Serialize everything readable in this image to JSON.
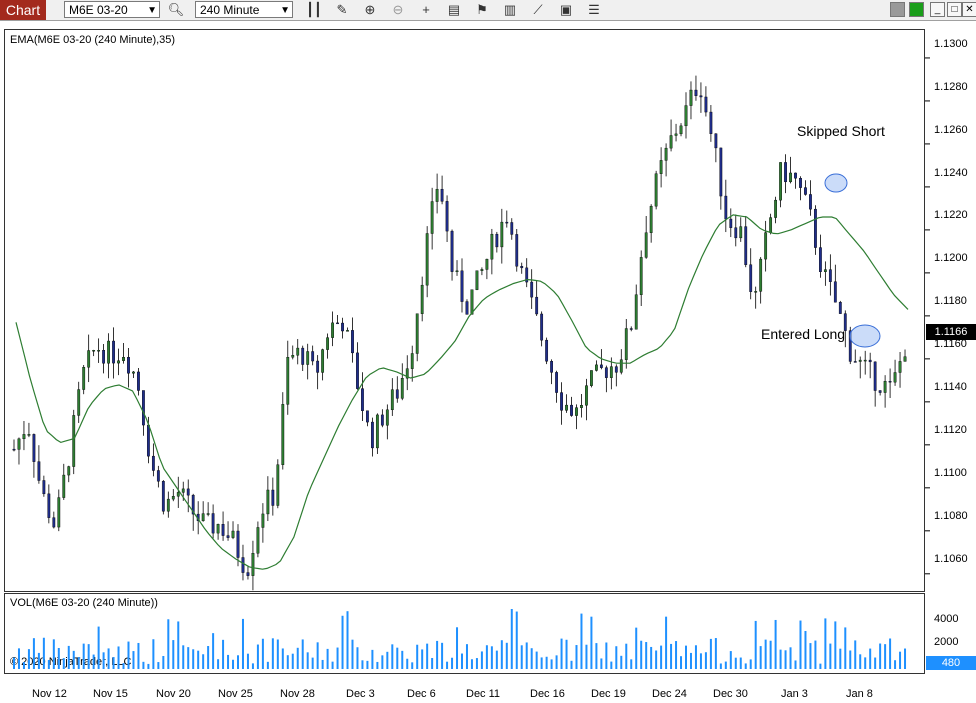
{
  "toolbar": {
    "tab_label": "Chart",
    "instrument": "M6E 03-20",
    "interval": "240 Minute",
    "icons": [
      "bar-type-icon",
      "draw-tool-icon",
      "zoom-in-icon",
      "zoom-out-icon",
      "crosshair-icon",
      "properties-icon",
      "strategies-icon",
      "indicators-icon",
      "chart-trader-icon",
      "data-box-icon",
      "menu-icon"
    ]
  },
  "window": {
    "buttons": [
      "",
      "",
      "□",
      "✕"
    ]
  },
  "panel1": {
    "label": "EMA(M6E 03-20 (240 Minute),35)"
  },
  "panel2": {
    "label": "VOL(M6E 03-20 (240 Minute))"
  },
  "copyright": "© 2020 NinjaTrader, LLC",
  "annotations": {
    "skipped": "Skipped Short",
    "entered": "Entered Long"
  },
  "colors": {
    "up": "#2e7d32",
    "down": "#1f2d8a",
    "ema": "#2e7d32",
    "volume": "#1e90ff",
    "highlight": "#6495ed"
  },
  "chart_data": {
    "type": "candlestick",
    "price_axis": {
      "ticks": [
        "1.1300",
        "1.1280",
        "1.1260",
        "1.1240",
        "1.1220",
        "1.1200",
        "1.1180",
        "1.1160",
        "1.1140",
        "1.1120",
        "1.1100",
        "1.1080",
        "1.1060"
      ],
      "range": [
        1.1052,
        1.1313
      ]
    },
    "last_price": "1.1166",
    "x_labels": [
      "Nov 12",
      "Nov 15",
      "Nov 20",
      "Nov 25",
      "Nov 28",
      "Dec 3",
      "Dec 6",
      "Dec 11",
      "Dec 16",
      "Dec 19",
      "Dec 24",
      "Dec 30",
      "Jan 3",
      "Jan 8"
    ],
    "price_path": [
      1.1118,
      1.1131,
      1.1098,
      1.1082,
      1.1115,
      1.1152,
      1.1166,
      1.1162,
      1.1164,
      1.115,
      1.1112,
      1.1092,
      1.1098,
      1.1089,
      1.1082,
      1.1083,
      1.1075,
      1.1062,
      1.109,
      1.1097,
      1.116,
      1.1163,
      1.1152,
      1.1175,
      1.1178,
      1.115,
      1.1122,
      1.1135,
      1.1145,
      1.1165,
      1.121,
      1.1245,
      1.12,
      1.1185,
      1.1198,
      1.1215,
      1.1228,
      1.12,
      1.118,
      1.116,
      1.114,
      1.1135,
      1.1148,
      1.1155,
      1.1158,
      1.1175,
      1.122,
      1.1245,
      1.1263,
      1.1275,
      1.129,
      1.126,
      1.1225,
      1.122,
      1.1185,
      1.122,
      1.1248,
      1.1243,
      1.1228,
      1.12,
      1.1185,
      1.1164,
      1.1155,
      1.115,
      1.1145,
      1.1166
    ],
    "ema_path": [
      1.1177,
      1.115,
      1.1127,
      1.1121,
      1.1123,
      1.1138,
      1.1146,
      1.1148,
      1.1145,
      1.1131,
      1.111,
      1.11,
      1.109,
      1.108,
      1.1072,
      1.1067,
      1.1063,
      1.1062,
      1.1065,
      1.1077,
      1.1098,
      1.1113,
      1.1128,
      1.1141,
      1.1152,
      1.1156,
      1.1154,
      1.1151,
      1.1153,
      1.116,
      1.1168,
      1.118,
      1.1188,
      1.1192,
      1.1195,
      1.1197,
      1.1196,
      1.119,
      1.1178,
      1.1165,
      1.116,
      1.1158,
      1.1158,
      1.1162,
      1.1165,
      1.1173,
      1.1193,
      1.1209,
      1.1222,
      1.1227,
      1.1226,
      1.122,
      1.1218,
      1.122,
      1.1223,
      1.1226,
      1.1226,
      1.1218,
      1.121,
      1.12,
      1.119,
      1.1183
    ],
    "volume_axis": {
      "ticks": [
        "4000",
        "2000"
      ],
      "range": [
        0,
        6000
      ]
    },
    "last_volume": "480"
  }
}
